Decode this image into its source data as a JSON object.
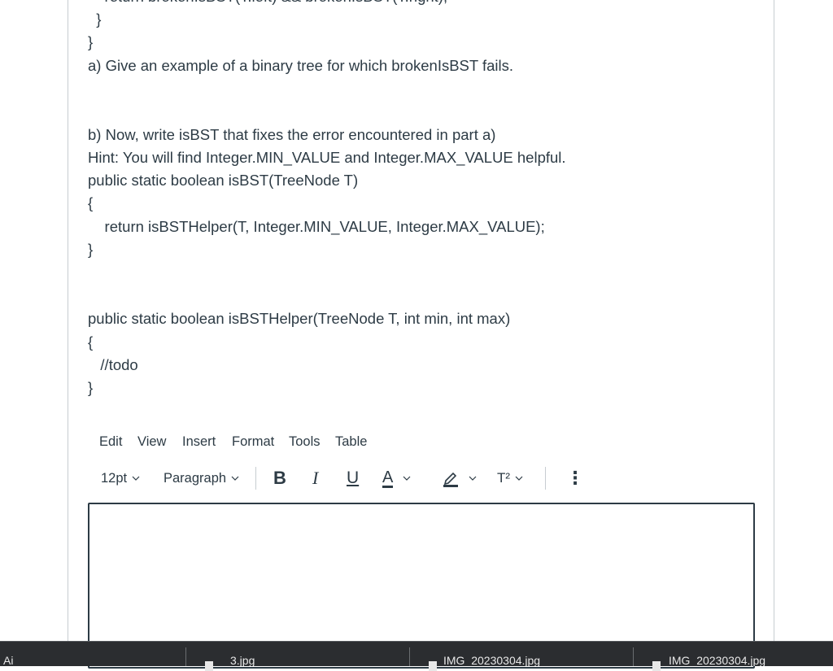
{
  "question": {
    "lines": [
      "    return brokenIsBST(T.left) && brokenIsBST(T.right);",
      "  }",
      "}",
      "a) Give an example of a binary tree for which brokenIsBST fails.",
      "b) Now, write isBST that fixes the error encountered in part a)",
      "Hint: You will find Integer.MIN_VALUE and Integer.MAX_VALUE helpful.",
      "public static boolean isBST(TreeNode T)",
      "{",
      "    return isBSTHelper(T, Integer.MIN_VALUE, Integer.MAX_VALUE);",
      "}",
      "public static boolean isBSTHelper(TreeNode T, int min, int max)",
      "{",
      "   //todo",
      "}"
    ]
  },
  "editor": {
    "menu": [
      "Edit",
      "View",
      "Insert",
      "Format",
      "Tools",
      "Table"
    ],
    "font_size": "12pt",
    "block_format": "Paragraph",
    "bold_label": "B",
    "italic_label": "I",
    "underline_label": "U",
    "text_color_label": "A",
    "superscript_label": "T²",
    "more_label": "⋮",
    "content": ""
  },
  "taskbar": {
    "items": [
      "Ai",
      "3.jpg",
      "IMG_20230304.jpg",
      "IMG_20230304.jpg"
    ]
  }
}
